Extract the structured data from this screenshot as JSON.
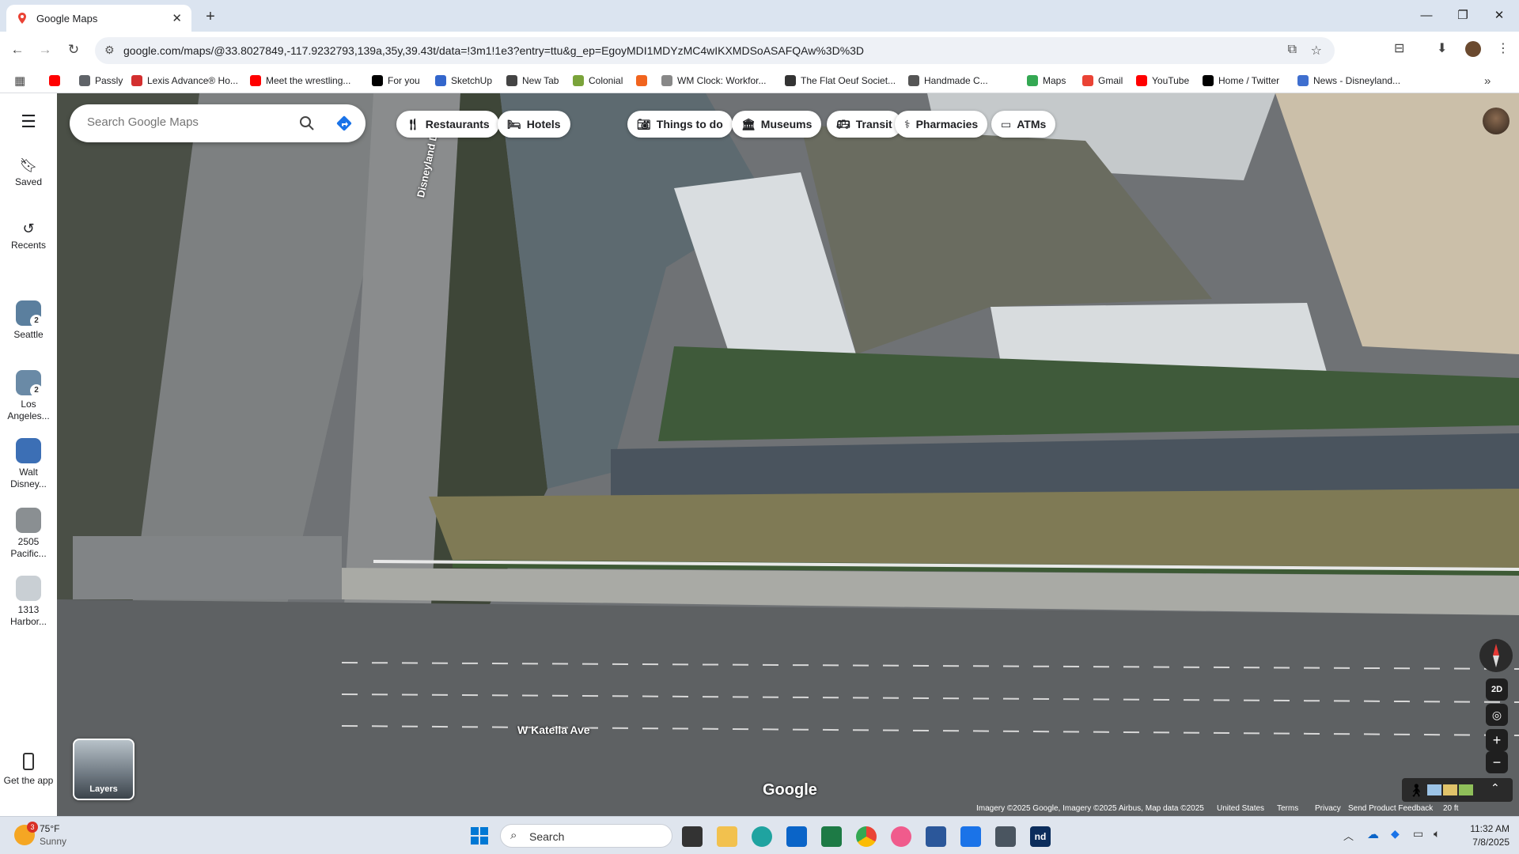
{
  "browser": {
    "tab_title": "Google Maps",
    "url": "google.com/maps/@33.8027849,-117.9232793,139a,35y,39.43t/data=!3m1!1e3?entry=ttu&g_ep=EgoyMDI1MDYzMC4wIKXMDSoASAFQAw%3D%3D",
    "bookmarks": [
      {
        "label": "",
        "icon": "youtube-icon",
        "color": "#ff0000"
      },
      {
        "label": "Passly",
        "icon": "passly-icon",
        "color": "#5f6368"
      },
      {
        "label": "Lexis Advance® Ho...",
        "icon": "lexis-icon",
        "color": "#d32f2f"
      },
      {
        "label": "Meet the wrestling...",
        "icon": "youtube-icon",
        "color": "#ff0000"
      },
      {
        "label": "For you",
        "icon": "x-icon",
        "color": "#000000"
      },
      {
        "label": "SketchUp",
        "icon": "sketchup-icon",
        "color": "#3366cc"
      },
      {
        "label": "New Tab",
        "icon": "globe-icon",
        "color": "#444444"
      },
      {
        "label": "Colonial",
        "icon": "grid-icon",
        "color": "#7aa33a"
      },
      {
        "label": "",
        "icon": "etsy-icon",
        "color": "#f1641e"
      },
      {
        "label": "WM Clock: Workfor...",
        "icon": "wm-icon",
        "color": "#888888"
      },
      {
        "label": "The Flat Oeuf Societ...",
        "icon": "doc-icon",
        "color": "#333333"
      },
      {
        "label": "Handmade C...",
        "icon": "handmade-icon",
        "color": "#555555"
      },
      {
        "label": "Maps",
        "icon": "maps-pin-icon",
        "color": "#34a853"
      },
      {
        "label": "Gmail",
        "icon": "gmail-icon",
        "color": "#ea4335"
      },
      {
        "label": "YouTube",
        "icon": "youtube-icon",
        "color": "#ff0000"
      },
      {
        "label": "Home / Twitter",
        "icon": "x-icon",
        "color": "#000000"
      },
      {
        "label": "News - Disneyland...",
        "icon": "news-icon",
        "color": "#3f6fcf"
      }
    ]
  },
  "maps": {
    "search_placeholder": "Search Google Maps",
    "rail": {
      "saved": "Saved",
      "recents": "Recents",
      "get_app": "Get the app",
      "places": [
        {
          "label": "Seattle",
          "badge": "2"
        },
        {
          "label": "Los Angeles...",
          "badge": "2"
        },
        {
          "label": "Walt Disney...",
          "badge": ""
        },
        {
          "label": "2505 Pacific...",
          "badge": ""
        },
        {
          "label": "1313 Harbor...",
          "badge": ""
        }
      ]
    },
    "chips": [
      {
        "label": "Restaurants",
        "icon": "fork-knife-icon"
      },
      {
        "label": "Hotels",
        "icon": "bed-icon"
      },
      {
        "label": "Things to do",
        "icon": "camera-icon"
      },
      {
        "label": "Museums",
        "icon": "museum-icon"
      },
      {
        "label": "Transit",
        "icon": "bus-icon"
      },
      {
        "label": "Pharmacies",
        "icon": "pharmacy-icon"
      },
      {
        "label": "ATMs",
        "icon": "atm-icon"
      }
    ],
    "street_labels": {
      "street1": "Disneyland Dr",
      "street2": "W Katella Ave"
    },
    "layers_label": "Layers",
    "view_toggle": "2D",
    "logo": "Google",
    "attribution": {
      "imagery": "Imagery ©2025 Google, Imagery ©2025 Airbus, Map data ©2025",
      "country": "United States",
      "terms": "Terms",
      "privacy": "Privacy",
      "feedback": "Send Product Feedback",
      "scale": "20 ft"
    }
  },
  "taskbar": {
    "weather_temp": "75°F",
    "weather_desc": "Sunny",
    "weather_badge": "3",
    "search_label": "Search",
    "time": "11:32 AM",
    "date": "7/8/2025"
  }
}
